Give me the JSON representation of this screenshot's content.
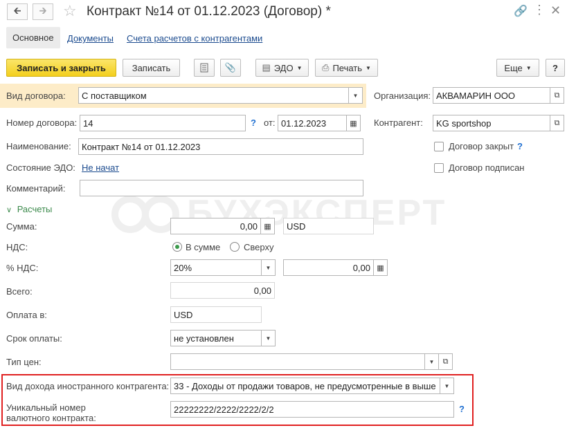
{
  "window": {
    "title": "Контракт №14 от 01.12.2023 (Договор) *"
  },
  "tabs": [
    {
      "label": "Основное"
    },
    {
      "label": "Документы"
    },
    {
      "label": "Счета расчетов с контрагентами"
    }
  ],
  "toolbar": {
    "save_close": "Записать и закрыть",
    "save": "Записать",
    "edo": "ЭДО",
    "print": "Печать",
    "more": "Еще",
    "help": "?"
  },
  "form": {
    "contract_type_label": "Вид договора:",
    "contract_type_value": "С поставщиком",
    "organization_label": "Организация:",
    "organization_value": "АКВАМАРИН ООО",
    "number_label": "Номер договора:",
    "number_value": "14",
    "date_label": "от:",
    "date_value": "01.12.2023",
    "counterparty_label": "Контрагент:",
    "counterparty_value": "KG sportshop",
    "name_label": "Наименование:",
    "name_value": "Контракт №14 от 01.12.2023",
    "closed_label": "Договор закрыт",
    "edo_state_label": "Состояние ЭДО:",
    "edo_state_value": "Не начат",
    "signed_label": "Договор подписан",
    "comment_label": "Комментарий:",
    "comment_value": ""
  },
  "settlements": {
    "section_label": "Расчеты",
    "sum_label": "Сумма:",
    "sum_value": "0,00",
    "currency_value": "USD",
    "vat_label": "НДС:",
    "vat_in_sum": "В сумме",
    "vat_on_top": "Сверху",
    "vat_rate_label": "% НДС:",
    "vat_rate_value": "20%",
    "vat_amount_value": "0,00",
    "total_label": "Всего:",
    "total_value": "0,00",
    "payment_in_label": "Оплата в:",
    "payment_in_value": "USD",
    "due_label": "Срок оплаты:",
    "due_value": "не установлен",
    "price_type_label": "Тип цен:",
    "price_type_value": ""
  },
  "foreign": {
    "income_type_label": "Вид дохода иностранного контрагента:",
    "income_type_value": "33 - Доходы от продажи товаров, не предусмотренные в выше",
    "unique_no_label_1": "Уникальный номер",
    "unique_no_label_2": "валютного контракта:",
    "unique_no_value": "22222222/2222/2222/2/2"
  },
  "watermark": "БУХЭКСПЕРТ",
  "colors": {
    "highlight": "#fdecc8",
    "red_frame": "#e02020",
    "accent_yellow": "#f3cf1d"
  }
}
